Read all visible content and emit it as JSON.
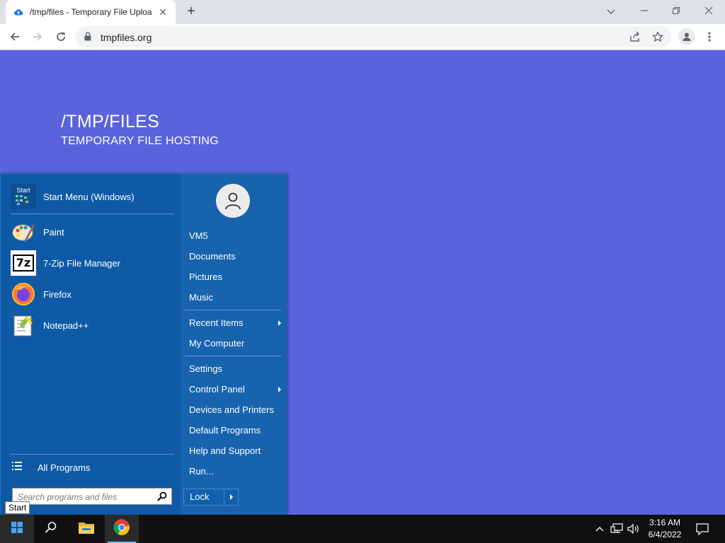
{
  "browser": {
    "tab_title": "/tmp/files - Temporary File Uploa",
    "tab_close": "✕",
    "new_tab": "+",
    "url": "tmpfiles.org"
  },
  "page": {
    "title": "/TMP/FILES",
    "subtitle": "TEMPORARY FILE HOSTING"
  },
  "start_menu": {
    "pinned": [
      {
        "label": "Start Menu (Windows)",
        "icon": "start-menu-icon"
      },
      {
        "label": "Paint",
        "icon": "paint-icon"
      },
      {
        "label": "7-Zip File Manager",
        "icon": "7zip-icon"
      },
      {
        "label": "Firefox",
        "icon": "firefox-icon"
      },
      {
        "label": "Notepad++",
        "icon": "notepadpp-icon"
      }
    ],
    "start_icon_text": "Start",
    "zip_icon_text": "7z",
    "all_programs": "All Programs",
    "search_placeholder": "Search programs and files",
    "right_items": [
      {
        "label": "VM5",
        "submenu": false
      },
      {
        "label": "Documents",
        "submenu": false
      },
      {
        "label": "Pictures",
        "submenu": false
      },
      {
        "label": "Music",
        "submenu": false
      },
      {
        "label": "Recent Items",
        "submenu": true
      },
      {
        "label": "My Computer",
        "submenu": false
      },
      {
        "label": "Settings",
        "submenu": false
      },
      {
        "label": "Control Panel",
        "submenu": true
      },
      {
        "label": "Devices and Printers",
        "submenu": false
      },
      {
        "label": "Default Programs",
        "submenu": false
      },
      {
        "label": "Help and Support",
        "submenu": false
      },
      {
        "label": "Run...",
        "submenu": false
      }
    ],
    "lock": "Lock"
  },
  "tooltip": "Start",
  "taskbar": {
    "time": "3:16 AM",
    "date": "6/4/2022"
  },
  "colors": {
    "page_bg": "#5a63dc",
    "start_menu_bg": "#0f5aa6",
    "taskbar_bg": "#101010"
  }
}
